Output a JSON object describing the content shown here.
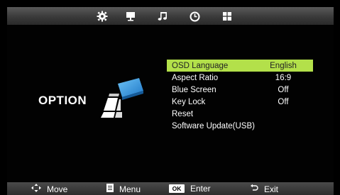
{
  "top_tabs": [
    {
      "name": "settings",
      "icon": "gear-icon"
    },
    {
      "name": "picture",
      "icon": "monitor-icon"
    },
    {
      "name": "audio",
      "icon": "music-note-icon"
    },
    {
      "name": "time",
      "icon": "clock-icon"
    },
    {
      "name": "option",
      "icon": "grid-icon"
    }
  ],
  "section_title": "OPTION",
  "menu": {
    "items": [
      {
        "label": "OSD Language",
        "value": "English",
        "selected": true
      },
      {
        "label": "Aspect Ratio",
        "value": "16:9"
      },
      {
        "label": "Blue Screen",
        "value": "Off"
      },
      {
        "label": "Key Lock",
        "value": "Off"
      },
      {
        "label": "Reset",
        "value": ""
      },
      {
        "label": "Software Update(USB)",
        "value": ""
      }
    ]
  },
  "bottom_hints": {
    "move": "Move",
    "menu": "Menu",
    "ok_key": "OK",
    "enter": "Enter",
    "exit": "Exit"
  },
  "colors": {
    "highlight": "#b3e04a",
    "logo_blue": "#2e8fd8"
  }
}
